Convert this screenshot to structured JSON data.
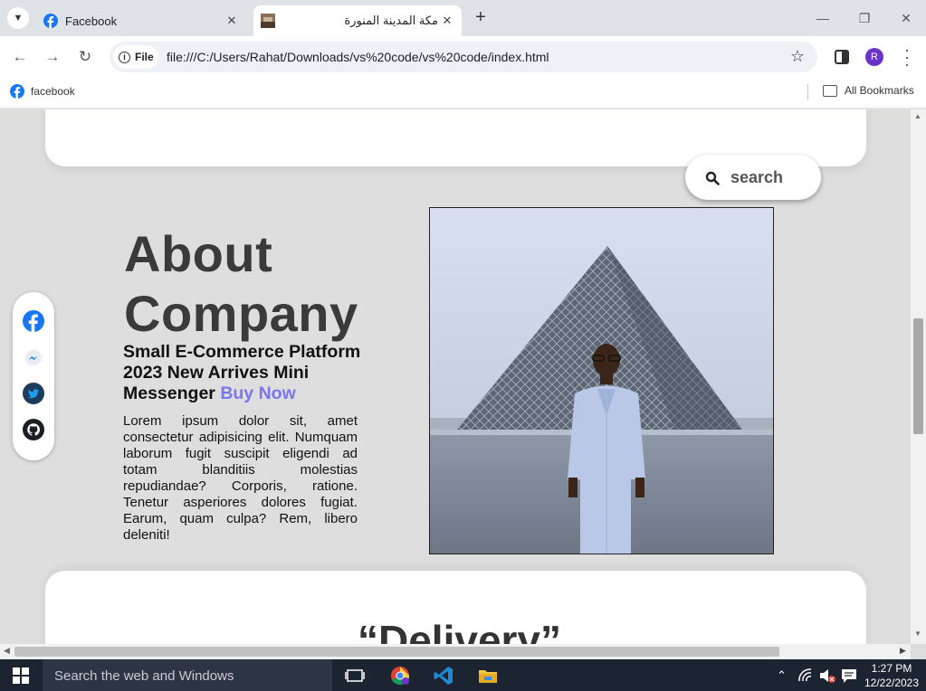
{
  "browser": {
    "tabs": [
      {
        "title": "Facebook",
        "active": false
      },
      {
        "title": "مكة المدينة المنورة",
        "active": true
      }
    ],
    "chip_label": "File",
    "url": "file:///C:/Users/Rahat/Downloads/vs%20code/vs%20code/index.html",
    "profile_initial": "R",
    "bookmarks": [
      {
        "label": "facebook"
      }
    ],
    "all_bookmarks_label": "All Bookmarks"
  },
  "page": {
    "search_label": "search",
    "about": {
      "title_line1": "About",
      "title_line2": "Company",
      "subtitle": "Small E-Commerce Platform 2023 New Arrives Mini Messenger",
      "buy_now": "Buy Now",
      "body": "Lorem ipsum dolor sit, amet consectetur adipisicing elit. Numquam laborum fugit suscipit eligendi ad totam blanditiis molestias repudiandae? Corporis, ratione. Tenetur asperiores dolores fugiat. Earum, quam culpa? Rem, libero deleniti!"
    },
    "social_icons": [
      "facebook-icon",
      "messenger-icon",
      "twitter-icon",
      "github-icon"
    ],
    "delivery_heading": "“Delivery”"
  },
  "taskbar": {
    "search_placeholder": "Search the web and Windows",
    "time": "1:27 PM",
    "date": "12/22/2023"
  },
  "colors": {
    "accent_buy": "#7b76f0",
    "facebook_blue": "#1877f2",
    "twitter_blue": "#1d9bf0",
    "profile_purple": "#6b33c7"
  }
}
